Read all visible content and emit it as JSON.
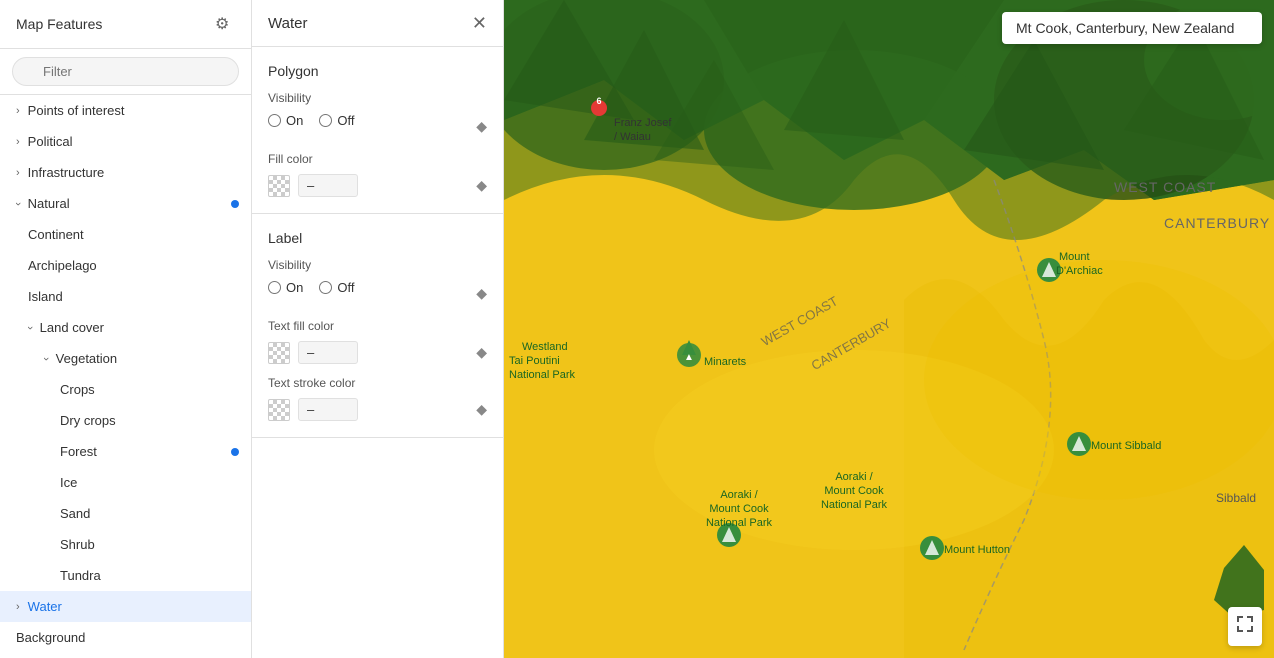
{
  "sidebar": {
    "title": "Map Features",
    "filter_placeholder": "Filter",
    "items": [
      {
        "id": "points-of-interest",
        "label": "Points of interest",
        "level": 0,
        "expandable": true,
        "expanded": false
      },
      {
        "id": "political",
        "label": "Political",
        "level": 0,
        "expandable": true,
        "expanded": false
      },
      {
        "id": "infrastructure",
        "label": "Infrastructure",
        "level": 0,
        "expandable": true,
        "expanded": false
      },
      {
        "id": "natural",
        "label": "Natural",
        "level": 0,
        "expandable": true,
        "expanded": true,
        "dot": true
      },
      {
        "id": "continent",
        "label": "Continent",
        "level": 1,
        "expandable": false
      },
      {
        "id": "archipelago",
        "label": "Archipelago",
        "level": 1,
        "expandable": false
      },
      {
        "id": "island",
        "label": "Island",
        "level": 1,
        "expandable": false
      },
      {
        "id": "land-cover",
        "label": "Land cover",
        "level": 1,
        "expandable": true,
        "expanded": true
      },
      {
        "id": "vegetation",
        "label": "Vegetation",
        "level": 2,
        "expandable": true,
        "expanded": true
      },
      {
        "id": "crops",
        "label": "Crops",
        "level": 3,
        "expandable": false
      },
      {
        "id": "dry-crops",
        "label": "Dry crops",
        "level": 3,
        "expandable": false
      },
      {
        "id": "forest",
        "label": "Forest",
        "level": 3,
        "expandable": false,
        "dot": true
      },
      {
        "id": "ice",
        "label": "Ice",
        "level": 3,
        "expandable": false
      },
      {
        "id": "sand",
        "label": "Sand",
        "level": 3,
        "expandable": false
      },
      {
        "id": "shrub",
        "label": "Shrub",
        "level": 3,
        "expandable": false
      },
      {
        "id": "tundra",
        "label": "Tundra",
        "level": 3,
        "expandable": false
      },
      {
        "id": "water",
        "label": "Water",
        "level": 0,
        "expandable": true,
        "expanded": false,
        "active": true
      },
      {
        "id": "background",
        "label": "Background",
        "level": 0,
        "expandable": false
      }
    ]
  },
  "panel": {
    "title": "Water",
    "polygon_section": {
      "title": "Polygon",
      "visibility_label": "Visibility",
      "on_label": "On",
      "off_label": "Off",
      "fill_color_label": "Fill color",
      "fill_color_value": "–"
    },
    "label_section": {
      "title": "Label",
      "visibility_label": "Visibility",
      "on_label": "On",
      "off_label": "Off",
      "text_fill_label": "Text fill color",
      "text_fill_value": "–",
      "text_stroke_label": "Text stroke color",
      "text_stroke_value": "–"
    }
  },
  "map": {
    "search_text": "Mt Cook, Canterbury, New Zealand"
  },
  "icons": {
    "gear": "⚙",
    "filter": "≡",
    "close": "✕",
    "diamond": "◆",
    "expand": "⛶",
    "chevron_right": "›",
    "chevron_down": "›"
  }
}
